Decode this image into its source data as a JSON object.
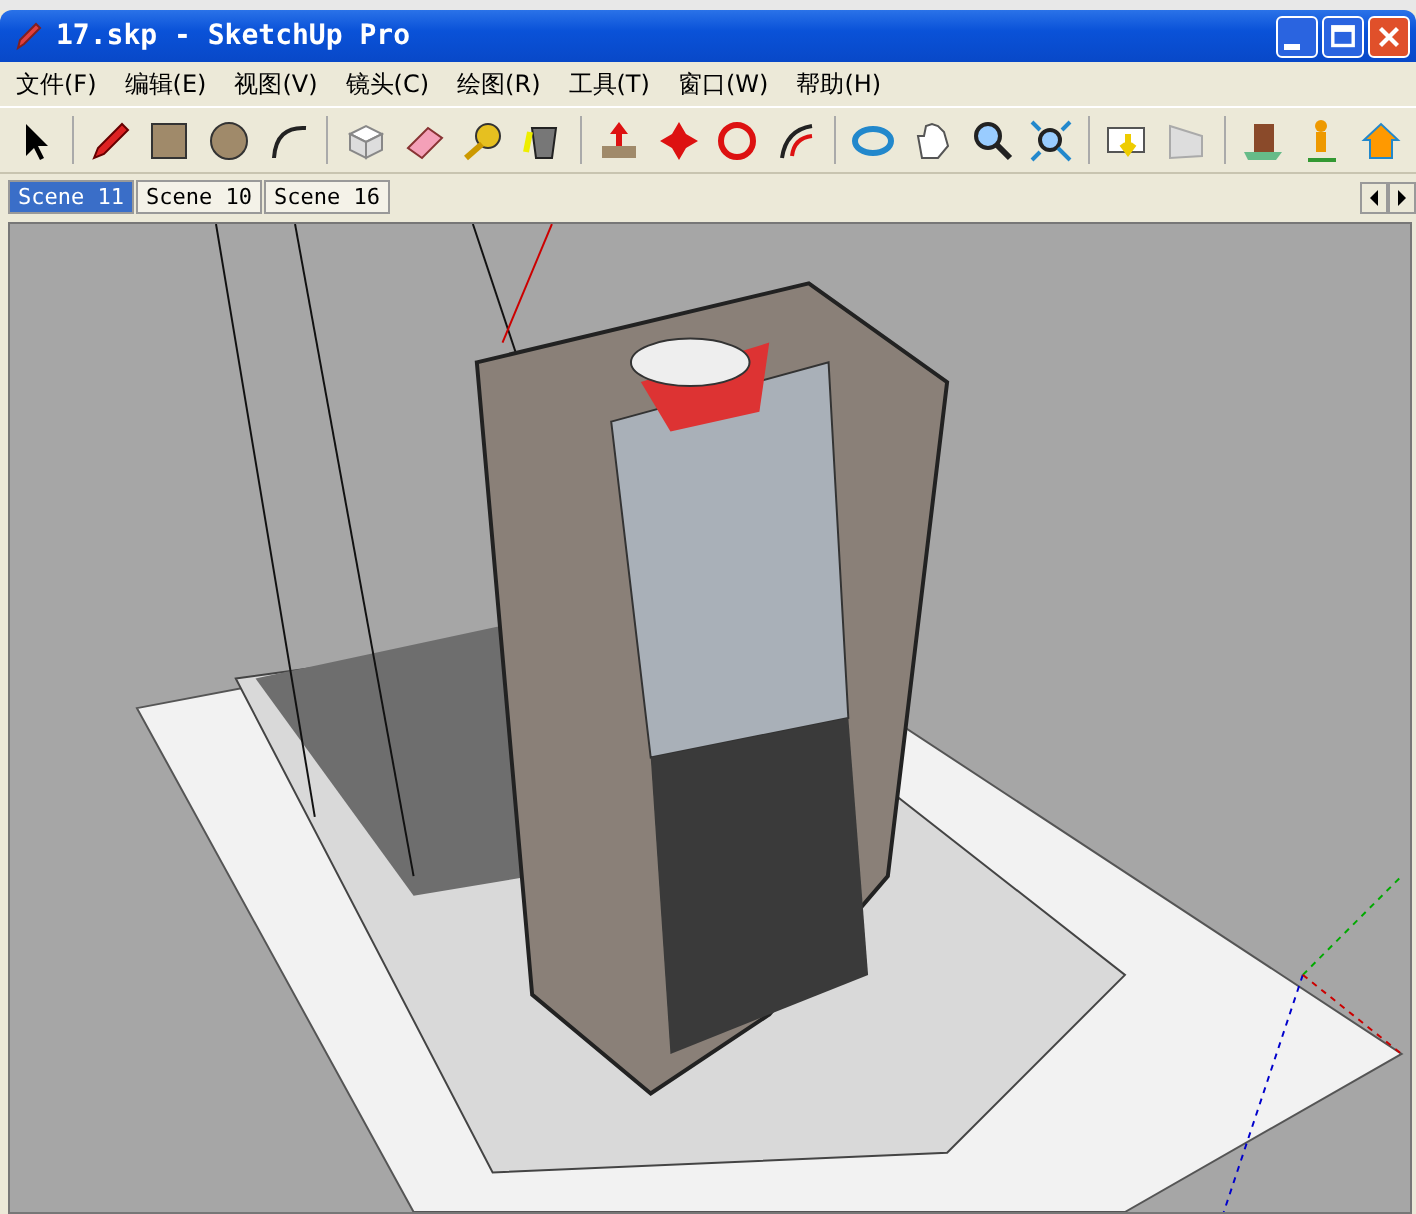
{
  "window": {
    "title": "17.skp - SketchUp Pro"
  },
  "menu": [
    "文件(F)",
    "编辑(E)",
    "视图(V)",
    "镜头(C)",
    "绘图(R)",
    "工具(T)",
    "窗口(W)",
    "帮助(H)"
  ],
  "scene_tabs": [
    {
      "label": "Scene 11",
      "selected": true
    },
    {
      "label": "Scene 10",
      "selected": false
    },
    {
      "label": "Scene 16",
      "selected": false
    }
  ]
}
